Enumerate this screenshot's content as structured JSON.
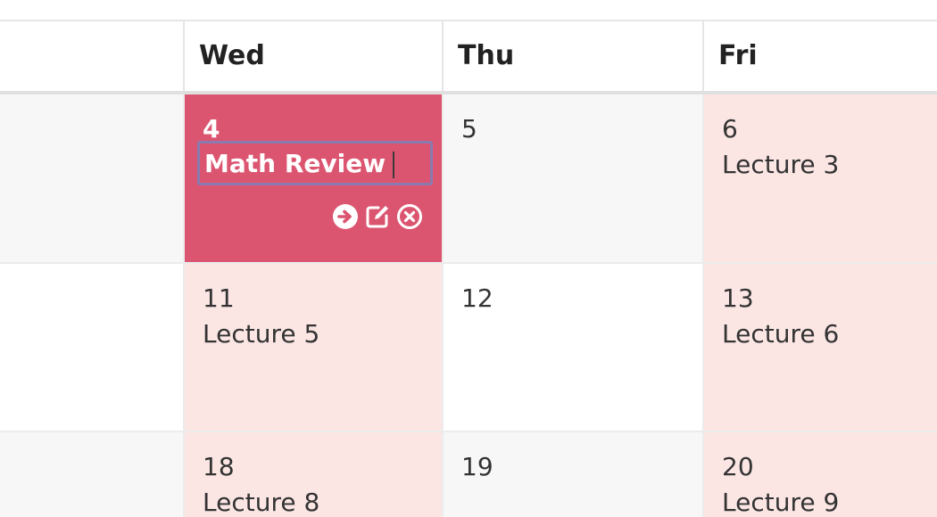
{
  "header": {
    "days": [
      "Wed",
      "Thu",
      "Fri"
    ]
  },
  "weeks": [
    {
      "wed": {
        "day": "4",
        "event": "Math Review"
      },
      "thu": {
        "day": "5",
        "event": ""
      },
      "fri": {
        "day": "6",
        "event": "Lecture 3"
      }
    },
    {
      "wed": {
        "day": "11",
        "event": "Lecture 5"
      },
      "thu": {
        "day": "12",
        "event": ""
      },
      "fri": {
        "day": "13",
        "event": "Lecture 6"
      }
    },
    {
      "wed": {
        "day": "18",
        "event": "Lecture 8"
      },
      "thu": {
        "day": "19",
        "event": ""
      },
      "fri": {
        "day": "20",
        "event": "Lecture 9"
      }
    }
  ],
  "active_event_actions": [
    "arrow-right-circle-icon",
    "edit-icon",
    "close-circle-icon"
  ],
  "colors": {
    "active_cell": "#dc5570",
    "lecture_cell": "#fbe6e4",
    "edit_border": "#8b7ab0"
  }
}
